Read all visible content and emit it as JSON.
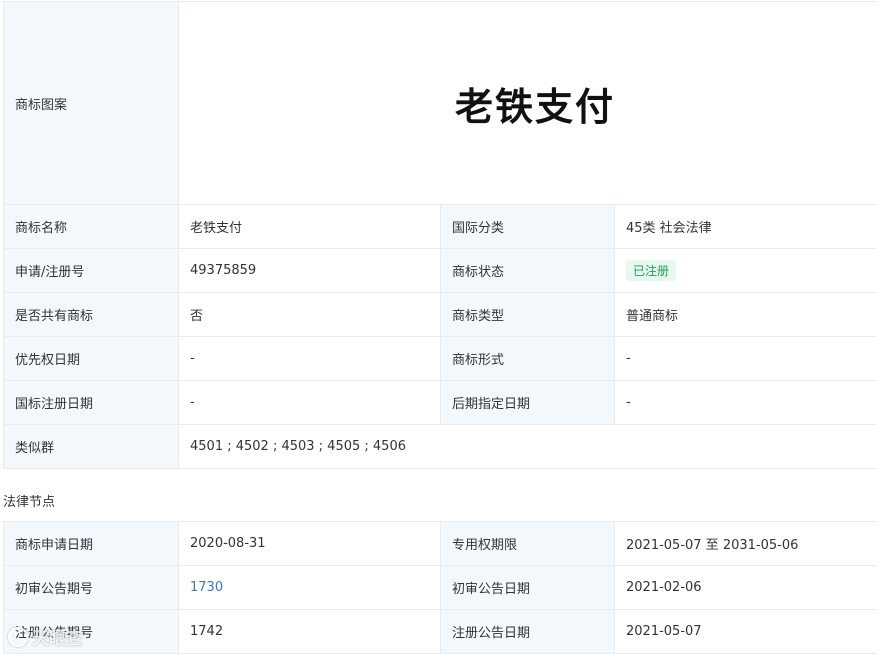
{
  "trademark_table": {
    "logo_label": "商标图案",
    "logo_text": "老铁支付",
    "rows": [
      {
        "l1": "商标名称",
        "v1": "老铁支付",
        "l2": "国际分类",
        "v2": "45类 社会法律"
      },
      {
        "l1": "申请/注册号",
        "v1": "49375859",
        "l2": "商标状态",
        "v2": "已注册"
      },
      {
        "l1": "是否共有商标",
        "v1": "否",
        "l2": "商标类型",
        "v2": "普通商标"
      },
      {
        "l1": "优先权日期",
        "v1": "-",
        "l2": "商标形式",
        "v2": "-"
      },
      {
        "l1": "国标注册日期",
        "v1": "-",
        "l2": "后期指定日期",
        "v2": "-"
      }
    ],
    "similar_group_label": "类似群",
    "similar_group_value": "4501 ; 4502 ; 4503 ; 4505 ; 4506"
  },
  "legal_section": {
    "title": "法律节点",
    "rows": [
      {
        "l1": "商标申请日期",
        "v1": "2020-08-31",
        "l2": "专用权期限",
        "v2": "2021-05-07 至 2031-05-06"
      },
      {
        "l1": "初审公告期号",
        "v1": "1730",
        "l2": "初审公告日期",
        "v2": "2021-02-06"
      },
      {
        "l1": "注册公告期号",
        "v1": "1742",
        "l2": "注册公告日期",
        "v2": "2021-05-07"
      }
    ]
  },
  "watermark": {
    "text": "天眼查"
  },
  "colors": {
    "label_bg": "#f2f8fc",
    "border": "#e8ecf1",
    "status_green": "#1aa15a",
    "link_blue": "#3b7bc2"
  }
}
